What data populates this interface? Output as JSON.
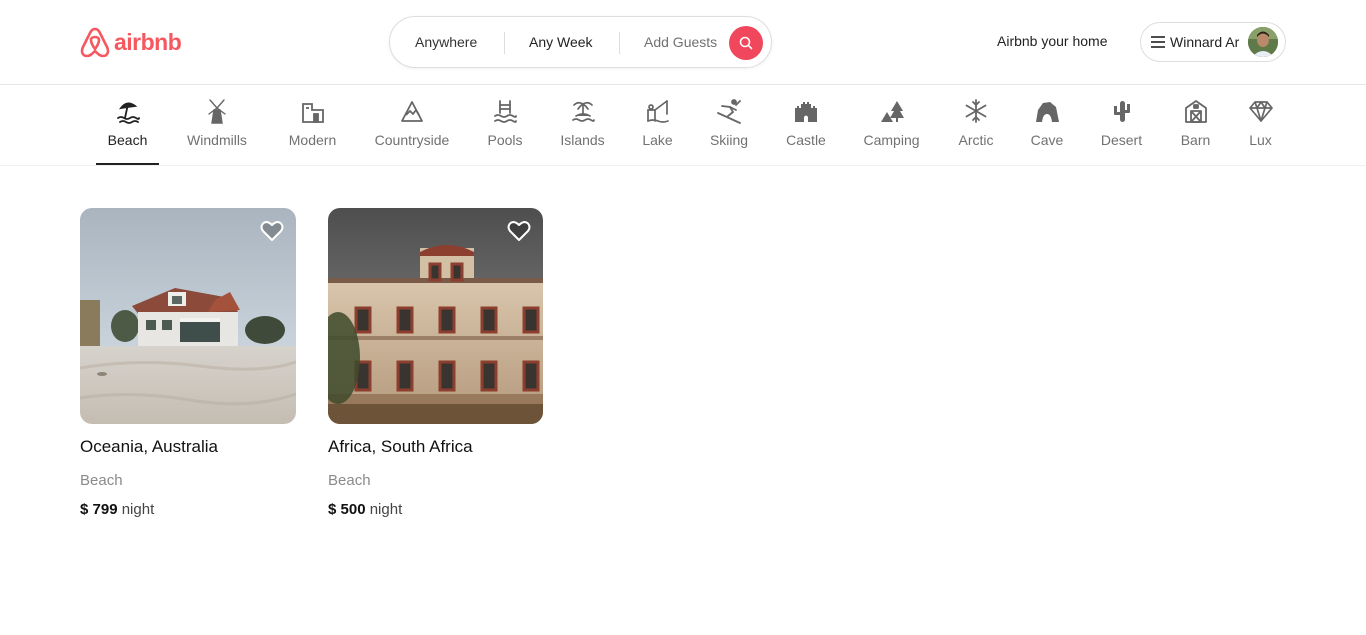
{
  "brand": {
    "name": "airbnb",
    "color": "#f5595f",
    "logo_icon": "airbnb-logo-icon"
  },
  "search": {
    "anywhere": "Anywhere",
    "week": "Any Week",
    "guests": "Add Guests",
    "button_icon": "search-icon",
    "accent": "#f0475c"
  },
  "header": {
    "host_link": "Airbnb your home",
    "user_name": "Winnard Ar",
    "menu_icon": "hamburger-icon"
  },
  "categories": [
    {
      "label": "Beach",
      "icon": "beach-icon",
      "active": true
    },
    {
      "label": "Windmills",
      "icon": "windmill-icon"
    },
    {
      "label": "Modern",
      "icon": "modern-icon"
    },
    {
      "label": "Countryside",
      "icon": "mountain-icon"
    },
    {
      "label": "Pools",
      "icon": "pool-icon"
    },
    {
      "label": "Islands",
      "icon": "island-icon"
    },
    {
      "label": "Lake",
      "icon": "lake-icon"
    },
    {
      "label": "Skiing",
      "icon": "skiing-icon"
    },
    {
      "label": "Castle",
      "icon": "castle-icon"
    },
    {
      "label": "Camping",
      "icon": "camping-icon"
    },
    {
      "label": "Arctic",
      "icon": "snowflake-icon"
    },
    {
      "label": "Cave",
      "icon": "cave-icon"
    },
    {
      "label": "Desert",
      "icon": "cactus-icon"
    },
    {
      "label": "Barn",
      "icon": "barn-icon"
    },
    {
      "label": "Lux",
      "icon": "diamond-icon"
    }
  ],
  "listings": [
    {
      "title": "Oceania, Australia",
      "category": "Beach",
      "price": "$ 799",
      "unit": "night",
      "image": "beach-house-photo"
    },
    {
      "title": "Africa, South Africa",
      "category": "Beach",
      "price": "$ 500",
      "unit": "night",
      "image": "historic-building-photo"
    }
  ]
}
